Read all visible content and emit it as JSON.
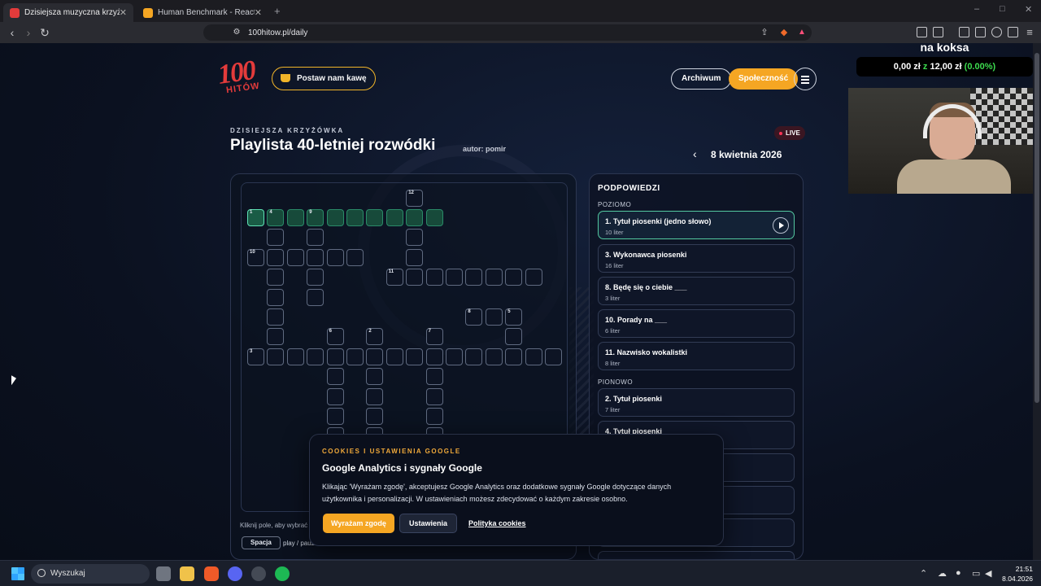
{
  "browser": {
    "tabs": [
      {
        "title": "Dzisiejsza muzyczna krzyżówka |",
        "active": true,
        "favicon_color": "#e33b3b"
      },
      {
        "title": "Human Benchmark - Reaction Time T",
        "active": false,
        "favicon_color": "#f5a623"
      }
    ],
    "new_tab": "+",
    "url": "100hitow.pl/daily",
    "window_controls": [
      "–",
      "□",
      "✕"
    ]
  },
  "header": {
    "logo_number": "100",
    "logo_text": "HITÓW",
    "coffee_label": "Postaw nam kawę",
    "archive_label": "Archiwum",
    "community_label": "Społeczność"
  },
  "hero": {
    "eyebrow": "DZISIEJSZA KRZYŻÓWKA",
    "title": "Playlista 40-letniej rozwódki",
    "author": "autor: pomir",
    "live": "LIVE",
    "date": "8 kwietnia 2026"
  },
  "board": {
    "hint": "Kliknij pole, aby wybrać",
    "key_space": "Spacja",
    "key_space_desc": "play / pauz"
  },
  "clues": {
    "heading": "PODPOWIEDZI",
    "across_label": "POZIOMO",
    "down_label": "PIONOWO",
    "across": [
      {
        "text": "1. Tytuł piosenki (jedno słowo)",
        "sub": "10 liter"
      },
      {
        "text": "3. Wykonawca piosenki",
        "sub": "16 liter"
      },
      {
        "text": "8. Będę się o ciebie ___",
        "sub": "3 liter"
      },
      {
        "text": "10. Porady na ___",
        "sub": "6 liter"
      },
      {
        "text": "11. Nazwisko wokalistki",
        "sub": "8 liter"
      }
    ],
    "down": [
      {
        "text": "2. Tytuł piosenki",
        "sub": "7 liter"
      },
      {
        "text": "4. Tytuł piosenki",
        "sub": ""
      }
    ]
  },
  "cookie": {
    "eyebrow": "COOKIES I USTAWIENIA GOOGLE",
    "heading": "Google Analytics i sygnały Google",
    "body": "Klikając 'Wyrażam zgodę', akceptujesz Google Analytics oraz dodatkowe sygnały Google dotyczące danych użytkownika i personalizacji. W ustawieniach możesz zdecydować o każdym zakresie osobno.",
    "agree": "Wyrażam zgodę",
    "settings": "Ustawienia",
    "policy": "Polityka cookies"
  },
  "overlay": {
    "title": "na koksa",
    "amount_current": "0,00 zł",
    "amount_sep": "z",
    "amount_goal": "12,00 zł",
    "percent": "(0.00%)"
  },
  "taskbar": {
    "search_placeholder": "Wyszukaj",
    "time": "21:51",
    "date": "8.04.2026"
  }
}
